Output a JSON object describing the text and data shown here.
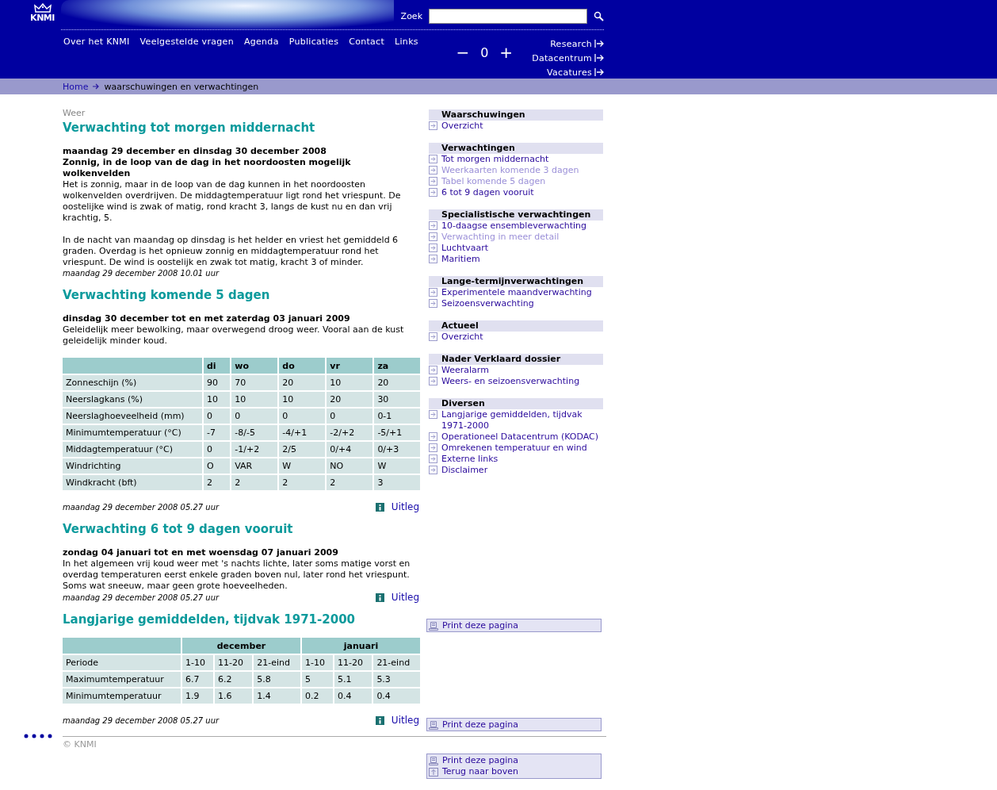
{
  "header": {
    "logo": "KNMI",
    "search_label": "Zoek",
    "nav": [
      "Over het KNMI",
      "Veelgestelde vragen",
      "Agenda",
      "Publicaties",
      "Contact",
      "Links"
    ],
    "font_size": {
      "decrease": "−",
      "value": "0",
      "increase": "+"
    },
    "side_links": [
      "Research",
      "Datacentrum",
      "Vacatures"
    ]
  },
  "breadcrumb": {
    "home": "Home",
    "current": "waarschuwingen en verwachtingen"
  },
  "category": "Weer",
  "sections": [
    {
      "title": "Verwachting tot morgen middernacht",
      "headings": [
        "maandag 29 december en dinsdag 30 december 2008",
        "Zonnig, in de loop van de dag in het noordoosten mogelijk wolkenvelden"
      ],
      "paragraphs": [
        "Het is zonnig, maar in de loop van de dag kunnen in het noordoosten wolkenvelden overdrijven. De middagtemperatuur ligt rond het vriespunt. De oostelijke wind is zwak of matig, rond kracht 3, langs de kust nu en dan vrij krachtig, 5.",
        "In de nacht van maandag op dinsdag is het helder en vriest het gemiddeld 6 graden. Overdag is het opnieuw zonnig en middagtemperatuur rond het vriespunt. De wind is oostelijk en zwak tot matig, kracht 3 of minder."
      ],
      "timestamp": "maandag 29 december 2008 10.01 uur"
    },
    {
      "title": "Verwachting komende 5 dagen",
      "headings": [
        "dinsdag 30 december tot en met zaterdag 03 januari 2009"
      ],
      "paragraphs": [
        "Geleidelijk meer bewolking, maar overwegend droog weer. Vooral aan de kust geleidelijk minder koud."
      ],
      "table": {
        "kind": "simple",
        "columns": [
          "",
          "di",
          "wo",
          "do",
          "vr",
          "za"
        ],
        "rows": [
          [
            "Zonneschijn (%)",
            "90",
            "70",
            "20",
            "10",
            "20"
          ],
          [
            "Neerslagkans (%)",
            "10",
            "10",
            "10",
            "20",
            "30"
          ],
          [
            "Neerslaghoeveelheid (mm)",
            "0",
            "0",
            "0",
            "0",
            "0-1"
          ],
          [
            "Minimumtemperatuur (°C)",
            "-7",
            "-8/-5",
            "-4/+1",
            "-2/+2",
            "-5/+1"
          ],
          [
            "Middagtemperatuur (°C)",
            "0",
            "-1/+2",
            "2/5",
            "0/+4",
            "0/+3"
          ],
          [
            "Windrichting",
            "O",
            "VAR",
            "W",
            "NO",
            "W"
          ],
          [
            "Windkracht (bft)",
            "2",
            "2",
            "2",
            "2",
            "3"
          ]
        ]
      },
      "timestamp": "maandag 29 december 2008 05.27 uur",
      "link": "Uitleg"
    },
    {
      "title": "Verwachting 6 tot 9 dagen vooruit",
      "headings": [
        "zondag 04 januari tot en met woensdag 07 januari 2009"
      ],
      "paragraphs": [
        "In het algemeen vrij koud weer met 's nachts lichte, later soms matige vorst en overdag temperaturen eerst enkele graden boven nul, later rond het vriespunt. Soms wat sneeuw, maar geen grote hoeveelheden."
      ],
      "timestamp": "maandag 29 december 2008 05.27 uur",
      "link": "Uitleg"
    },
    {
      "title": "Langjarige gemiddelden, tijdvak 1971-2000",
      "table": {
        "kind": "grouped",
        "columns": [
          "",
          {
            "label": "december",
            "colspan": 3
          },
          {
            "label": "januari",
            "colspan": 3
          }
        ],
        "rows": [
          [
            "Periode",
            "1-10",
            "11-20",
            "21-eind",
            "1-10",
            "11-20",
            "21-eind"
          ],
          [
            "Maximumtemperatuur",
            "6.7",
            "6.2",
            "5.8",
            "5",
            "5.1",
            "5.3"
          ],
          [
            "Minimumtemperatuur",
            "1.9",
            "1.6",
            "1.4",
            "0.2",
            "0.4",
            "0.4"
          ]
        ]
      },
      "timestamp": "maandag 29 december 2008 05.27 uur",
      "link": "Uitleg"
    }
  ],
  "sidebar": [
    {
      "title": "Waarschuwingen",
      "items": [
        {
          "label": "Overzicht",
          "visited": false
        }
      ]
    },
    {
      "title": "Verwachtingen",
      "items": [
        {
          "label": "Tot morgen middernacht",
          "visited": false
        },
        {
          "label": "Weerkaarten komende 3 dagen",
          "visited": true
        },
        {
          "label": "Tabel komende 5 dagen",
          "visited": true
        },
        {
          "label": "6 tot 9 dagen vooruit",
          "visited": false
        }
      ]
    },
    {
      "title": "Specialistische verwachtingen",
      "items": [
        {
          "label": "10-daagse ensembleverwachting",
          "visited": false
        },
        {
          "label": "Verwachting in meer detail",
          "visited": true
        },
        {
          "label": "Luchtvaart",
          "visited": false
        },
        {
          "label": "Maritiem",
          "visited": false
        }
      ]
    },
    {
      "title": "Lange-termijnverwachtingen",
      "items": [
        {
          "label": "Experimentele maandverwachting",
          "visited": false
        },
        {
          "label": "Seizoensverwachting",
          "visited": false
        }
      ]
    },
    {
      "title": "Actueel",
      "items": [
        {
          "label": "Overzicht",
          "visited": false
        }
      ]
    },
    {
      "title": "Nader Verklaard dossier",
      "items": [
        {
          "label": "Weeralarm",
          "visited": false
        },
        {
          "label": "Weers- en seizoensverwachting",
          "visited": false
        }
      ]
    },
    {
      "title": "Diversen",
      "items": [
        {
          "label": "Langjarige gemiddelden, tijdvak 1971-2000",
          "visited": false
        },
        {
          "label": "Operationeel Datacentrum (KODAC)",
          "visited": false
        },
        {
          "label": "Omrekenen temperatuur en wind",
          "visited": false
        },
        {
          "label": "Externe links",
          "visited": false
        },
        {
          "label": "Disclaimer",
          "visited": false
        }
      ]
    }
  ],
  "print_boxes": [
    {
      "items": [
        {
          "kind": "print",
          "label": "Print deze pagina"
        }
      ]
    },
    {
      "items": [
        {
          "kind": "print",
          "label": "Print deze pagina"
        }
      ]
    },
    {
      "items": [
        {
          "kind": "print",
          "label": "Print deze pagina"
        },
        {
          "kind": "top",
          "label": "Terug naar boven"
        }
      ]
    }
  ],
  "footer": {
    "copyright": "© KNMI"
  }
}
